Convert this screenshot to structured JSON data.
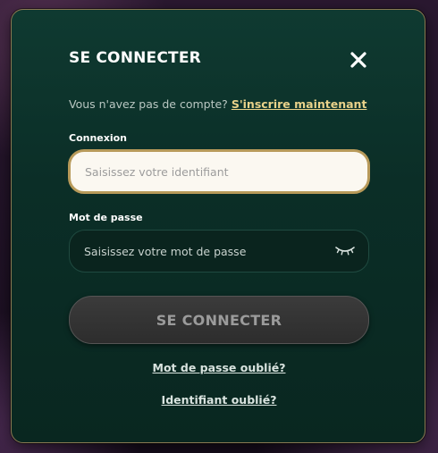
{
  "modal": {
    "title": "SE CONNECTER",
    "close_icon": "close-icon"
  },
  "register": {
    "prompt": "Vous n'avez pas de compte?",
    "link": "S'inscrire maintenant"
  },
  "login_field": {
    "label": "Connexion",
    "placeholder": "Saisissez votre identifiant",
    "value": ""
  },
  "password_field": {
    "label": "Mot de passe",
    "placeholder": "Saisissez votre mot de passe",
    "value": "",
    "toggle_icon": "eye-closed-icon"
  },
  "submit": {
    "label": "SE CONNECTER"
  },
  "links": {
    "forgot_password": "Mot de passe oublié?",
    "forgot_id": "Identifiant oublié?"
  },
  "colors": {
    "modal_bg": "#0b2e27",
    "accent_gold": "#e9d28a",
    "input_border": "#b89a5a",
    "button_bg": "#333333"
  }
}
